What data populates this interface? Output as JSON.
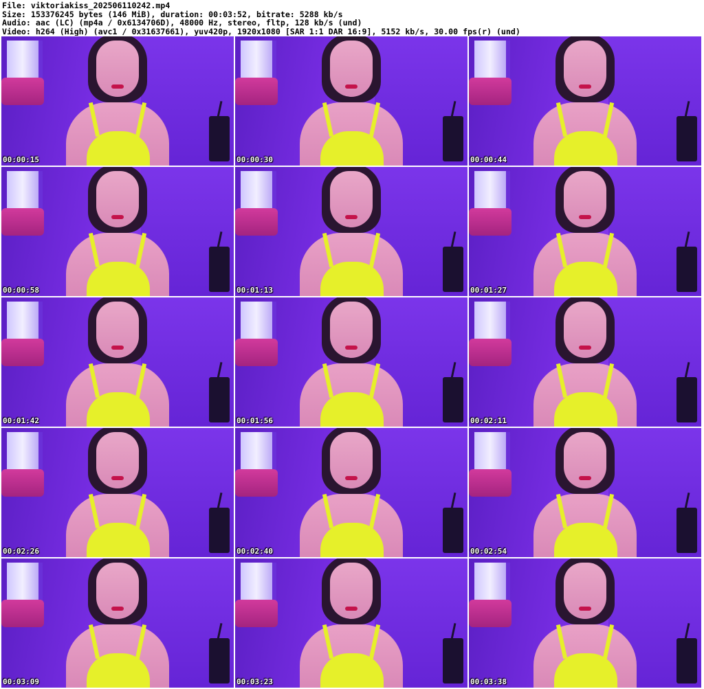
{
  "header": {
    "file_line": "File: viktoriakiss_202506110242.mp4",
    "size_line": "Size: 153376245 bytes (146 MiB), duration: 00:03:52, bitrate: 5288 kb/s",
    "audio_line": "Audio: aac (LC) (mp4a / 0x6134706D), 48000 Hz, stereo, fltp, 128 kb/s (und)",
    "video_line": "Video: h264 (High) (avc1 / 0x31637661), yuv420p, 1920x1080 [SAR 1:1 DAR 16:9], 5152 kb/s, 30.00 fps(r) (und)"
  },
  "thumbnails": [
    {
      "timestamp": "00:00:15"
    },
    {
      "timestamp": "00:00:30"
    },
    {
      "timestamp": "00:00:44"
    },
    {
      "timestamp": "00:00:58"
    },
    {
      "timestamp": "00:01:13"
    },
    {
      "timestamp": "00:01:27"
    },
    {
      "timestamp": "00:01:42"
    },
    {
      "timestamp": "00:01:56"
    },
    {
      "timestamp": "00:02:11"
    },
    {
      "timestamp": "00:02:26"
    },
    {
      "timestamp": "00:02:40"
    },
    {
      "timestamp": "00:02:54"
    },
    {
      "timestamp": "00:03:09"
    },
    {
      "timestamp": "00:03:23"
    },
    {
      "timestamp": "00:03:38"
    }
  ],
  "colors": {
    "background": "#ffffff",
    "scene_purple": "#7a2ee6",
    "top_yellow": "#e6f02a",
    "timestamp_text": "#ffffff"
  }
}
